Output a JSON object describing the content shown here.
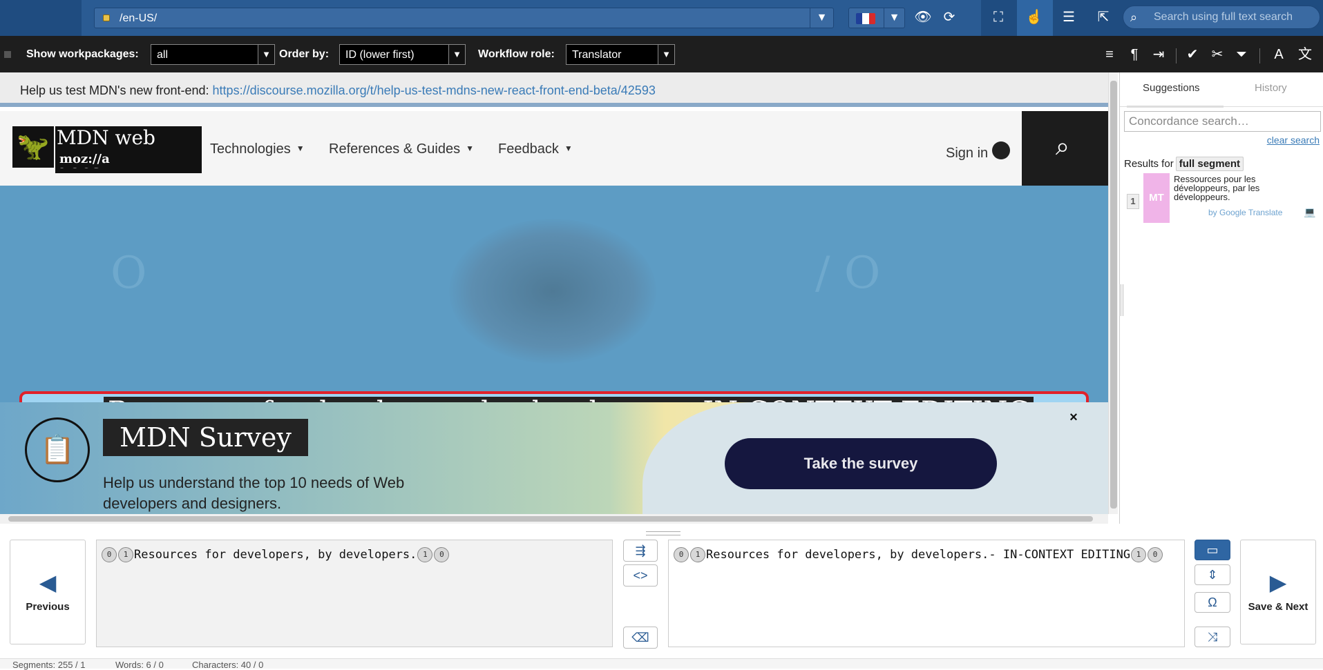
{
  "toolbar": {
    "url": "/en-US/",
    "search_placeholder": "Search using full text search"
  },
  "workpackages": {
    "show_label": "Show workpackages:",
    "show_value": "all",
    "order_label": "Order by:",
    "order_value": "ID (lower first)",
    "role_label": "Workflow role:",
    "role_value": "Translator"
  },
  "page": {
    "notice_text": "Help us test MDN's new front-end: ",
    "notice_link": "https://discourse.mozilla.org/t/help-us-test-mdns-new-react-front-end-beta/42593",
    "logo_name": "MDN web docs",
    "logo_moz": "moz://a",
    "nav": [
      "Technologies",
      "References & Guides",
      "Feedback"
    ],
    "sign_in": "Sign in",
    "incontext_text": "Resources for developers, by developers.- IN-CONTEXT EDITING",
    "survey_title": "MDN Survey",
    "survey_desc": "Help us understand the top 10 needs of Web developers and designers.",
    "survey_button": "Take the survey",
    "survey_close": "×"
  },
  "panel": {
    "tabs": [
      "Suggestions",
      "History"
    ],
    "concordance_placeholder": "Concordance search…",
    "clear_search": "clear search",
    "results_for": "Results for",
    "results_tag": "full segment",
    "suggestion": {
      "index": "1",
      "badge": "MT",
      "text": "Ressources pour les développeurs, par les développeurs.",
      "source": "by Google Translate"
    }
  },
  "editor": {
    "previous": "Previous",
    "save_next": "Save & Next",
    "source_text": "Resources for developers, by developers.",
    "target_text": "Resources for developers, by developers.- IN-CONTEXT EDITING",
    "ph_outer": "0",
    "ph_inner": "1"
  },
  "status": {
    "segments": "Segments: 255 / 1",
    "words": "Words: 6 / 0",
    "characters": "Characters: 40 / 0"
  },
  "colors": {
    "topbar": "#2a5b93",
    "highlight_border": "#e0212a",
    "mt_badge": "#f0b4e8"
  }
}
